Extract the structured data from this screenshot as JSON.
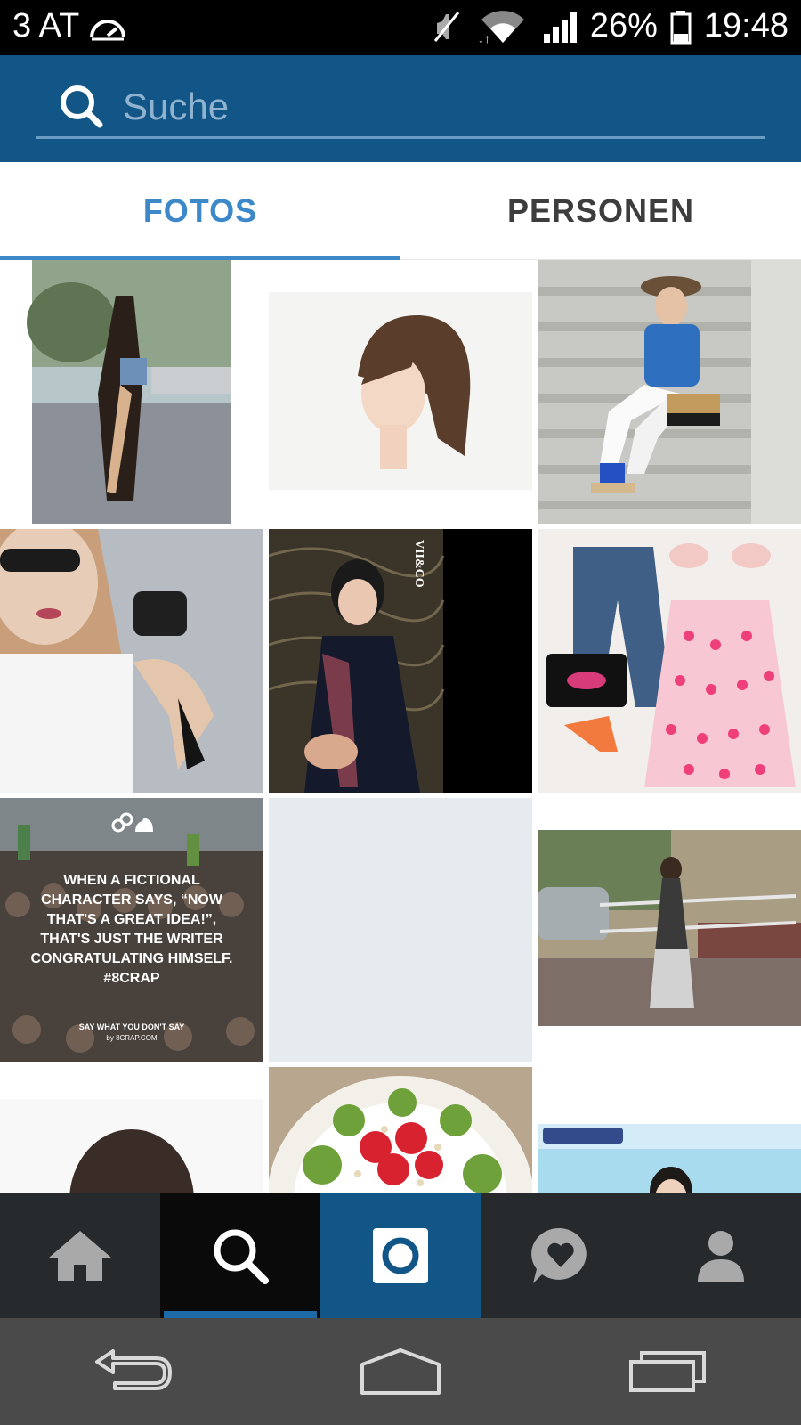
{
  "status_bar": {
    "carrier": "3 AT",
    "battery": "26%",
    "time": "19:48",
    "icons": [
      "speedometer-icon",
      "mute-icon",
      "wifi-icon",
      "signal-icon",
      "battery-icon"
    ]
  },
  "search": {
    "placeholder": "Suche",
    "icon": "search-icon"
  },
  "tabs": [
    {
      "label": "FOTOS",
      "active": true
    },
    {
      "label": "PERSONEN",
      "active": false
    }
  ],
  "grid": {
    "meme_text": "WHEN A FICTIONAL CHARACTER SAYS, “NOW THAT'S A GREAT IDEA!”, THAT'S JUST THE WRITER CONGRATULATING HIMSELF. #8CRAP",
    "meme_footer": "SAY WHAT YOU DON'T SAY",
    "meme_site": "by 8CRAP.COM",
    "brand_text": "VII&CO"
  },
  "bottom_nav": {
    "items": [
      "home-icon",
      "search-icon",
      "camera-icon",
      "activity-heart-icon",
      "profile-icon"
    ],
    "active": "search-icon"
  },
  "system_nav": [
    "back-icon",
    "home-icon",
    "recents-icon"
  ],
  "colors": {
    "brand_blue": "#125688",
    "tab_active": "#3d88c8",
    "nav_bg": "#262a2d"
  }
}
